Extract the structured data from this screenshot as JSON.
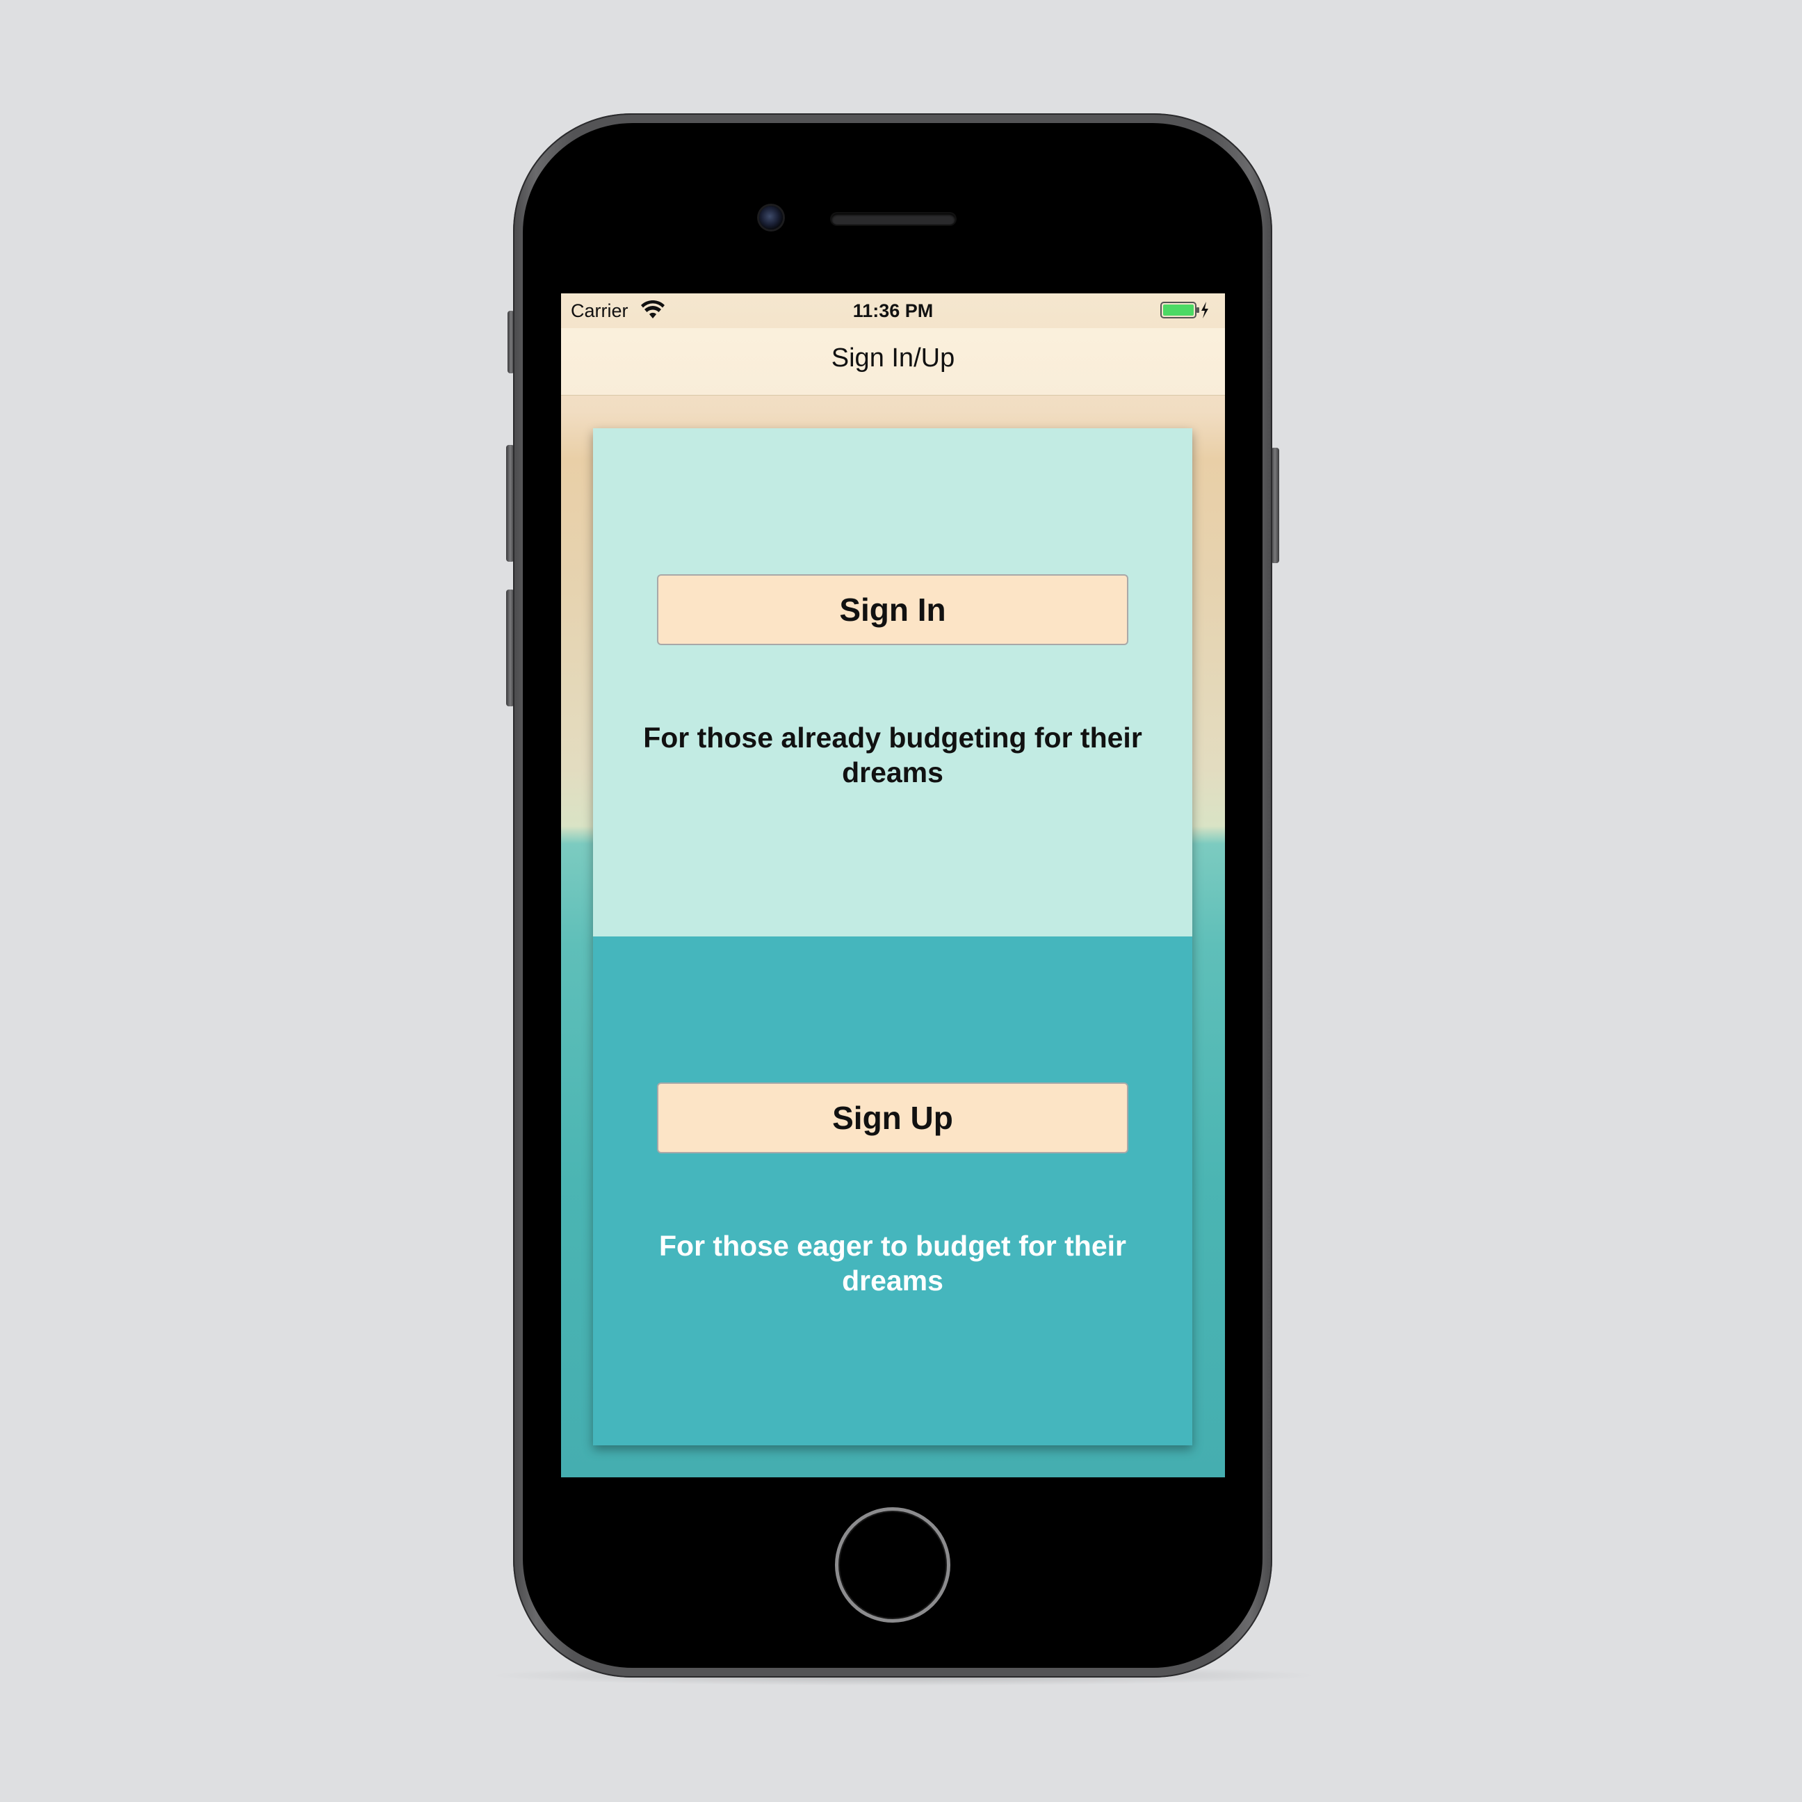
{
  "status_bar": {
    "carrier": "Carrier",
    "time": "11:36 PM",
    "wifi_icon": "wifi-icon",
    "battery_icon": "battery-charging-icon"
  },
  "nav": {
    "title": "Sign In/Up"
  },
  "sign_in": {
    "button_label": "Sign In",
    "caption": "For those already budgeting for their dreams"
  },
  "sign_up": {
    "button_label": "Sign Up",
    "caption": "For those eager to budget for their dreams"
  },
  "colors": {
    "card_top": "#c2ebe3",
    "card_bottom": "#45b6bd",
    "button_fill": "#fce4c6",
    "battery_fill": "#4cd964"
  }
}
